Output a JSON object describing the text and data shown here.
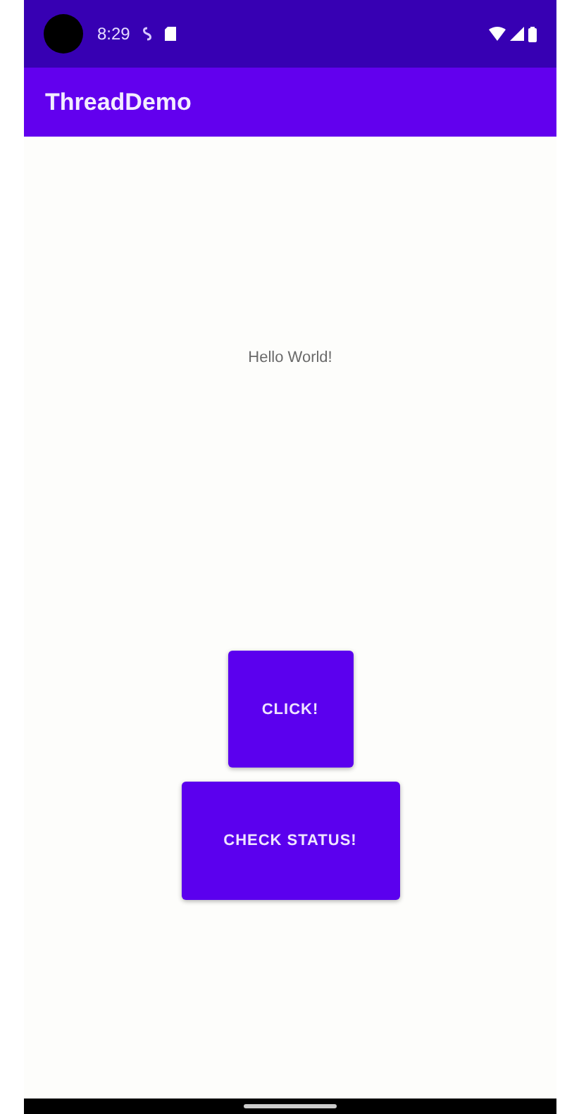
{
  "status_bar": {
    "time": "8:29"
  },
  "app_bar": {
    "title": "ThreadDemo"
  },
  "content": {
    "message": "Hello World!"
  },
  "buttons": [
    {
      "label": "CLICK!",
      "kind": "small"
    },
    {
      "label": "CHECK STATUS!",
      "kind": "wide"
    }
  ]
}
